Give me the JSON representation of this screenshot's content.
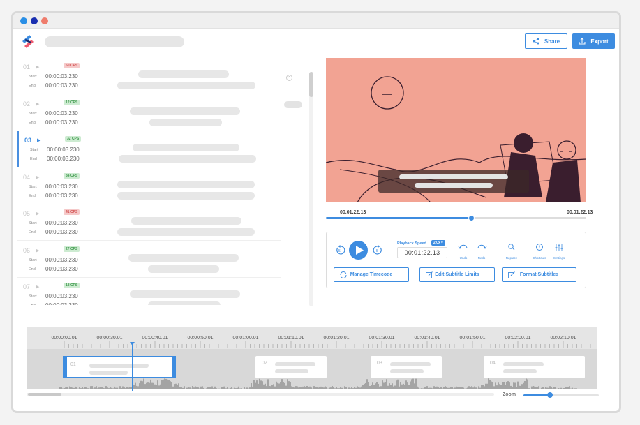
{
  "colors": {
    "accent": "#3d8ce0",
    "video_bg": "#f2a393",
    "cps_red": "#f5c9c9",
    "cps_green": "#cdebd1"
  },
  "window": {
    "dots": [
      "#2a8fe6",
      "#1a2fb0",
      "#ef7c6c"
    ]
  },
  "header": {
    "share_label": "Share",
    "export_label": "Export"
  },
  "subtitles": {
    "start_label": "Start",
    "end_label": "End",
    "items": [
      {
        "number": "01",
        "cps": "60 CPS",
        "cps_status": "red",
        "start": "00:00:03.230",
        "end": "00:00:03.230",
        "active": false
      },
      {
        "number": "02",
        "cps": "12 CPS",
        "cps_status": "green",
        "start": "00:00:03.230",
        "end": "00:00:03.230",
        "active": false
      },
      {
        "number": "03",
        "cps": "32 CPS",
        "cps_status": "green",
        "start": "00:00:03.230",
        "end": "00:00:03.230",
        "active": true
      },
      {
        "number": "04",
        "cps": "34 CPS",
        "cps_status": "green",
        "start": "00:00:03.230",
        "end": "00:00:03.230",
        "active": false
      },
      {
        "number": "05",
        "cps": "41 CPS",
        "cps_status": "red",
        "start": "00:00:03.230",
        "end": "00:00:03.230",
        "active": false
      },
      {
        "number": "06",
        "cps": "27 CPS",
        "cps_status": "green",
        "start": "00:00:03.230",
        "end": "00:00:03.230",
        "active": false
      },
      {
        "number": "07",
        "cps": "18 CPS",
        "cps_status": "green",
        "start": "00:00:03.230",
        "end": "00:00:03.230",
        "active": false
      }
    ]
  },
  "player": {
    "current_time": "00.01.22:13",
    "duration": "00.01.22:13",
    "progress": 0.56,
    "speed_label": "Playback Speed",
    "speed_value": "2.0x ▾",
    "timecode": "00:01:22.13",
    "tools": [
      {
        "label": "Undo",
        "icon": "undo-icon"
      },
      {
        "label": "Redo",
        "icon": "redo-icon"
      },
      {
        "label": "Replace",
        "icon": "search-icon"
      },
      {
        "label": "Shortcuts",
        "icon": "clock-icon"
      },
      {
        "label": "Settings",
        "icon": "sliders-icon"
      }
    ],
    "actions": [
      {
        "label": "Manage Timecode",
        "icon": "sync-icon"
      },
      {
        "label": "Edit Subtitle Limits",
        "icon": "edit-icon"
      },
      {
        "label": "Format Subtitles",
        "icon": "edit-icon"
      }
    ]
  },
  "timeline": {
    "ticks": [
      "00:00:00.01",
      "00:00:30.01",
      "00:00:40.01",
      "00:00:50.01",
      "00:01:00.01",
      "00:01:10.01",
      "00:01:20.01",
      "00:01:30.01",
      "00:01:40.01",
      "00:01:50.01",
      "00:02:00.01",
      "00:02:10.01"
    ],
    "clips": [
      "01",
      "02",
      "03",
      "04"
    ],
    "zoom_label": "Zoom",
    "zoom_level": 0.35
  }
}
